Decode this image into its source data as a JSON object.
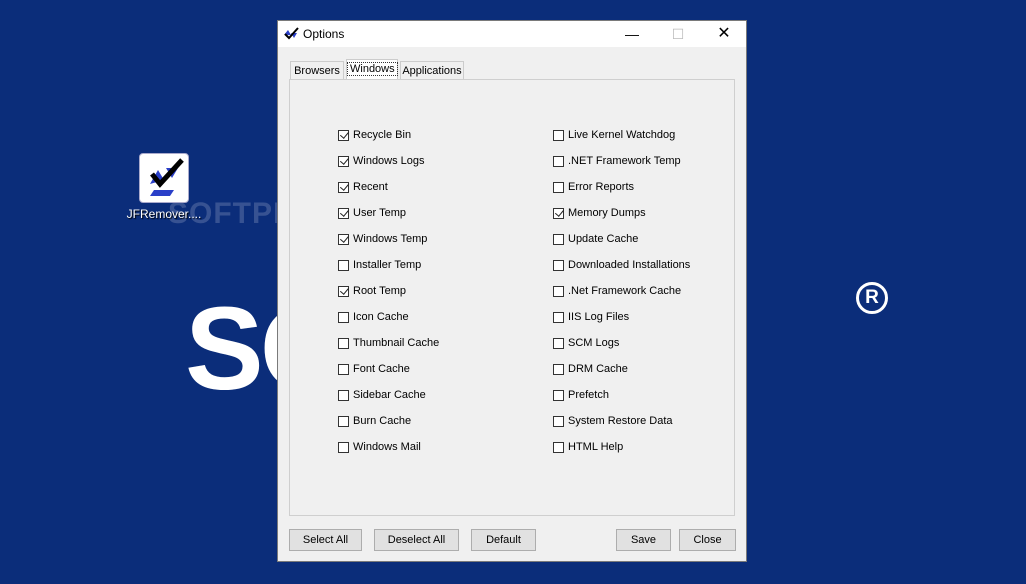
{
  "desktop": {
    "icon_label": "JFRemover....",
    "watermark": "SOFTPEDIA",
    "bg_logo": "SO       IA",
    "bg_reg": "R"
  },
  "window": {
    "title": "Options",
    "controls": {
      "minimize": "—",
      "maximize": "☐",
      "close": "✕"
    },
    "tabs": [
      {
        "label": "Browsers",
        "active": false
      },
      {
        "label": "Windows",
        "active": true
      },
      {
        "label": "Applications",
        "active": false
      }
    ],
    "left_column": [
      {
        "label": "Recycle Bin",
        "checked": true
      },
      {
        "label": "Windows Logs",
        "checked": true
      },
      {
        "label": "Recent",
        "checked": true
      },
      {
        "label": "User Temp",
        "checked": true
      },
      {
        "label": "Windows Temp",
        "checked": true
      },
      {
        "label": "Installer Temp",
        "checked": false
      },
      {
        "label": "Root Temp",
        "checked": true
      },
      {
        "label": "Icon Cache",
        "checked": false
      },
      {
        "label": "Thumbnail Cache",
        "checked": false
      },
      {
        "label": "Font Cache",
        "checked": false
      },
      {
        "label": "Sidebar Cache",
        "checked": false
      },
      {
        "label": "Burn Cache",
        "checked": false
      },
      {
        "label": "Windows Mail",
        "checked": false
      }
    ],
    "right_column": [
      {
        "label": "Live Kernel Watchdog",
        "checked": false
      },
      {
        "label": ".NET Framework Temp",
        "checked": false
      },
      {
        "label": "Error Reports",
        "checked": false
      },
      {
        "label": "Memory Dumps",
        "checked": true
      },
      {
        "label": "Update Cache",
        "checked": false
      },
      {
        "label": "Downloaded Installations",
        "checked": false
      },
      {
        "label": ".Net Framework Cache",
        "checked": false
      },
      {
        "label": "IIS Log Files",
        "checked": false
      },
      {
        "label": "SCM Logs",
        "checked": false
      },
      {
        "label": "DRM Cache",
        "checked": false
      },
      {
        "label": "Prefetch",
        "checked": false
      },
      {
        "label": "System Restore Data",
        "checked": false
      },
      {
        "label": "HTML Help",
        "checked": false
      }
    ],
    "buttons": {
      "select_all": "Select All",
      "deselect_all": "Deselect All",
      "default": "Default",
      "save": "Save",
      "close": "Close"
    }
  }
}
